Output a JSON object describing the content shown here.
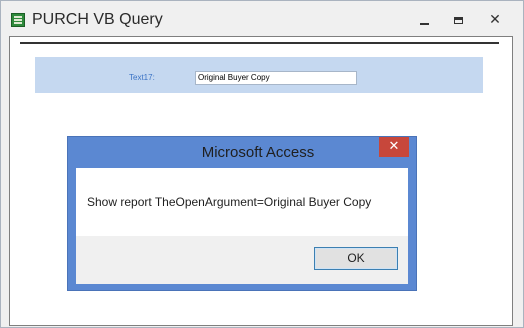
{
  "window": {
    "title": "PURCH VB Query",
    "icon": "access-form-icon",
    "controls": {
      "minimize": "minimize-icon",
      "maximize": "maximize-icon",
      "close": "✕"
    }
  },
  "form": {
    "field_label": "Text17:",
    "field_value": "Original Buyer Copy"
  },
  "dialog": {
    "title": "Microsoft Access",
    "close": "✕",
    "message": "Show report TheOpenArgument=Original Buyer Copy",
    "ok_label": "OK"
  },
  "colors": {
    "dialog_frame": "#5b88d2",
    "dialog_close": "#c7473b",
    "form_header": "#c5d8f0",
    "label_text": "#3b73c5"
  }
}
